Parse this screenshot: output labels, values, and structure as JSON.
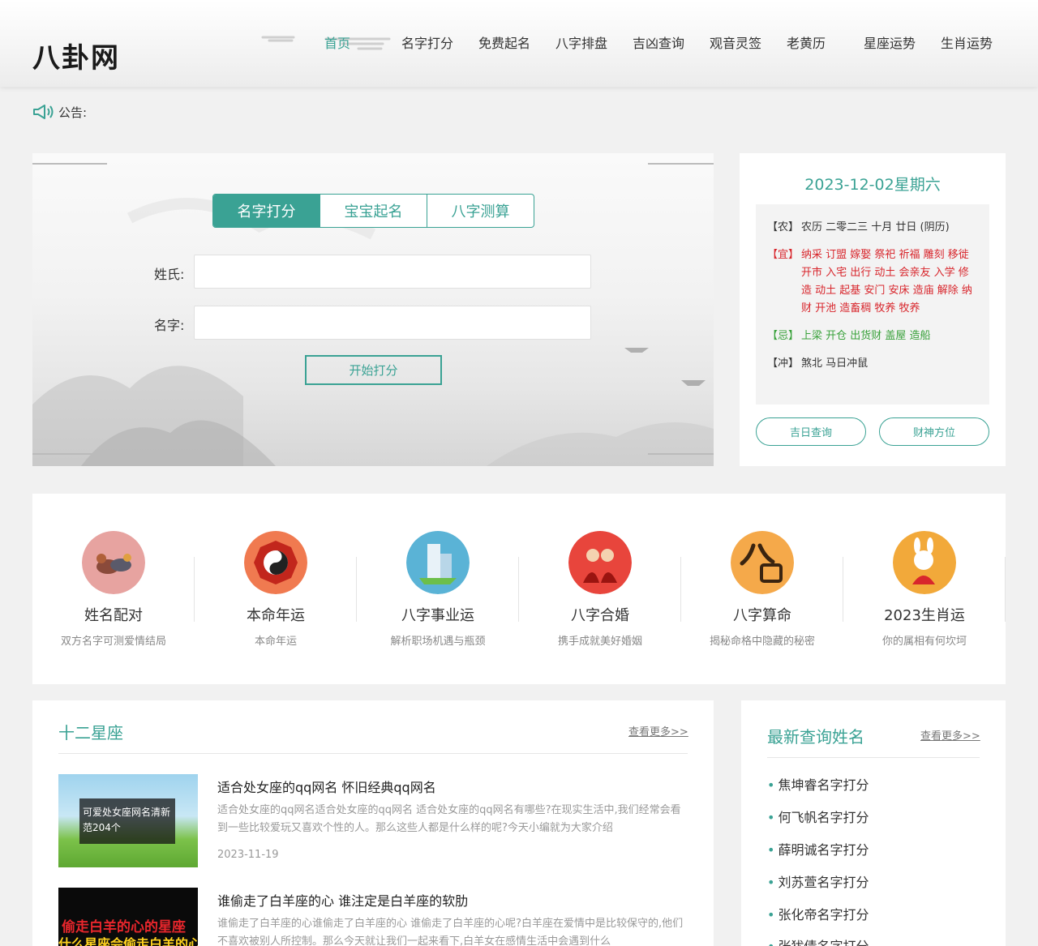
{
  "header": {
    "logo": "八卦网",
    "nav": [
      {
        "label": "首页",
        "active": true
      },
      {
        "label": "名字打分"
      },
      {
        "label": "免费起名"
      },
      {
        "label": "八字排盘"
      },
      {
        "label": "吉凶查询"
      },
      {
        "label": "观音灵签"
      },
      {
        "label": "老黄历"
      },
      {
        "label": "星座运势"
      },
      {
        "label": "生肖运势"
      }
    ]
  },
  "notice": {
    "label": "公告:"
  },
  "search": {
    "tabs": [
      "名字打分",
      "宝宝起名",
      "八字测算"
    ],
    "surname_label": "姓氏:",
    "name_label": "名字:",
    "submit": "开始打分"
  },
  "almanac": {
    "date": "2023-12-02星期六",
    "lunar_key": "【农】",
    "lunar_val": "农历 二零二三 十月 廿日 (阴历)",
    "yi_key": "【宜】",
    "yi_val": "纳采 订盟 嫁娶 祭祀 祈福 雕刻 移徙 开市 入宅 出行 动土 会亲友 入学 修造 动土 起基 安门 安床 造庙 解除 纳财 开池 造畜稠 牧养 牧养",
    "ji_key": "【忌】",
    "ji_val": "上梁 开仓 出货财 盖屋 造船",
    "chong_key": "【冲】",
    "chong_val": "煞北 马日冲鼠",
    "btn_jiri": "吉日查询",
    "btn_caishen": "财神方位"
  },
  "features": [
    {
      "title": "姓名配对",
      "desc": "双方名字可测爱情结局",
      "icon": "mandarin-ducks-icon"
    },
    {
      "title": "本命年运",
      "desc": "本命年运",
      "icon": "bagua-icon"
    },
    {
      "title": "八字事业运",
      "desc": "解析职场机遇与瓶颈",
      "icon": "office-building-icon"
    },
    {
      "title": "八字合婚",
      "desc": "携手成就美好婚姻",
      "icon": "wedding-couple-icon"
    },
    {
      "title": "八字算命",
      "desc": "揭秘命格中隐藏的秘密",
      "icon": "bazi-character-icon"
    },
    {
      "title": "2023生肖运",
      "desc": "你的属相有何坎坷",
      "icon": "rabbit-zodiac-icon"
    }
  ],
  "zodiac": {
    "title": "十二星座",
    "more": "查看更多>>",
    "articles": [
      {
        "title": "适合处女座的qq网名 怀旧经典qq网名",
        "summary": "适合处女座的qq网名适合处女座的qq网名 适合处女座的qq网名有哪些?在现实生活中,我们经常会看到一些比较爱玩又喜欢个性的人。那么这些人都是什么样的呢?今天小编就为大家介绍",
        "date": "2023-11-19",
        "thumb_text": "可爱处女座网名清新范204个"
      },
      {
        "title": "谁偷走了白羊座的心 谁注定是白羊座的软肋",
        "summary": "谁偷走了白羊座的心谁偷走了白羊座的心 谁偷走了白羊座的心呢?白羊座在爱情中是比较保守的,他们不喜欢被别人所控制。那么今天就让我们一起来看下,白羊女在感情生活中会遇到什么",
        "date": "",
        "thumb_line1": "偷走白羊的心的星座",
        "thumb_line2": "什么星座会偷走白羊的心"
      }
    ]
  },
  "latest_names": {
    "title": "最新查询姓名",
    "more": "查看更多>>",
    "items": [
      "焦坤睿名字打分",
      "何飞帆名字打分",
      "薛明诚名字打分",
      "刘苏萱名字打分",
      "张化帝名字打分",
      "张犹倩名字打分"
    ]
  },
  "colors": {
    "accent": "#3aa294",
    "red": "#d8262c",
    "green": "#38a13a"
  }
}
